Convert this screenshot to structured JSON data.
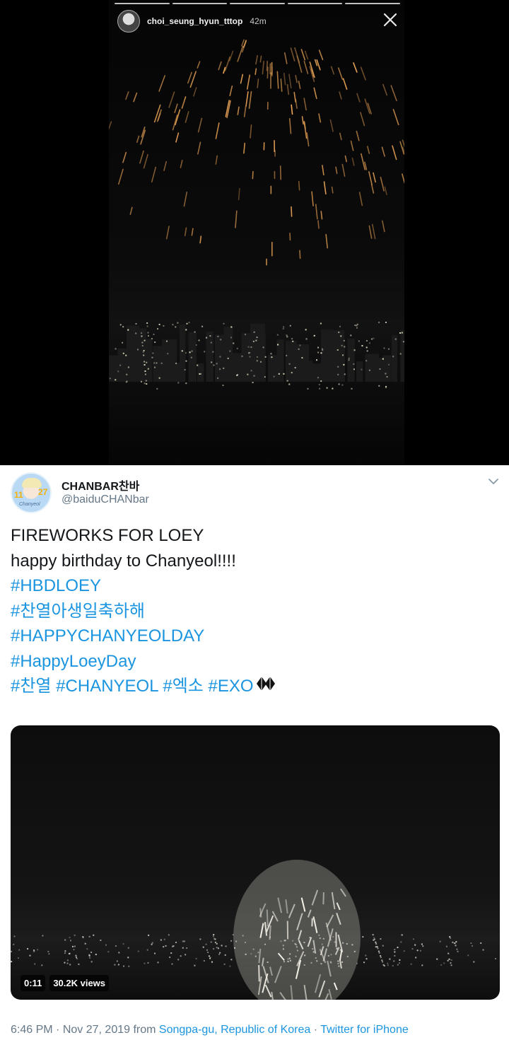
{
  "story": {
    "username": "choi_seung_hyun_tttop",
    "time_ago": "42m",
    "progress_segments": 5,
    "icons": {
      "avatar": "profile-avatar",
      "close": "close-icon"
    }
  },
  "tweet": {
    "display_name": "CHANBAR찬바",
    "handle": "@baiduCHANbar",
    "text_lines": [
      {
        "parts": [
          {
            "text": "FIREWORKS FOR LOEY",
            "tag": false
          }
        ]
      },
      {
        "parts": [
          {
            "text": "happy birthday to Chanyeol!!!!",
            "tag": false
          }
        ]
      },
      {
        "parts": [
          {
            "text": "#HBDLOEY",
            "tag": true
          }
        ]
      },
      {
        "parts": [
          {
            "text": "#찬열아생일축하해",
            "tag": true
          }
        ]
      },
      {
        "parts": [
          {
            "text": "#HAPPYCHANYEOLDAY",
            "tag": true
          }
        ]
      },
      {
        "parts": [
          {
            "text": "#HappyLoeyDay",
            "tag": true
          }
        ]
      },
      {
        "parts": [
          {
            "text": "#찬열",
            "tag": true
          },
          {
            "text": " ",
            "tag": false
          },
          {
            "text": "#CHANYEOL",
            "tag": true
          },
          {
            "text": " ",
            "tag": false
          },
          {
            "text": "#엑소",
            "tag": true
          },
          {
            "text": " ",
            "tag": false
          },
          {
            "text": "#EXO",
            "tag": true
          }
        ],
        "emoji": "exo-hashflag-icon"
      }
    ],
    "avatar_badge": {
      "left_number": "11",
      "right_number": "27",
      "caption": "Chanyeol"
    },
    "video": {
      "duration": "0:11",
      "views": "30.2K views"
    },
    "footer": {
      "time": "6:46 PM",
      "date": "Nov 27, 2019",
      "from_label": "from",
      "location": "Songpa-gu, Republic of Korea",
      "separator": "·",
      "source": "Twitter for iPhone"
    },
    "colors": {
      "link": "#1b95e0",
      "text": "#14171a",
      "muted": "#657786"
    },
    "icons": {
      "menu": "chevron-down-icon"
    }
  }
}
